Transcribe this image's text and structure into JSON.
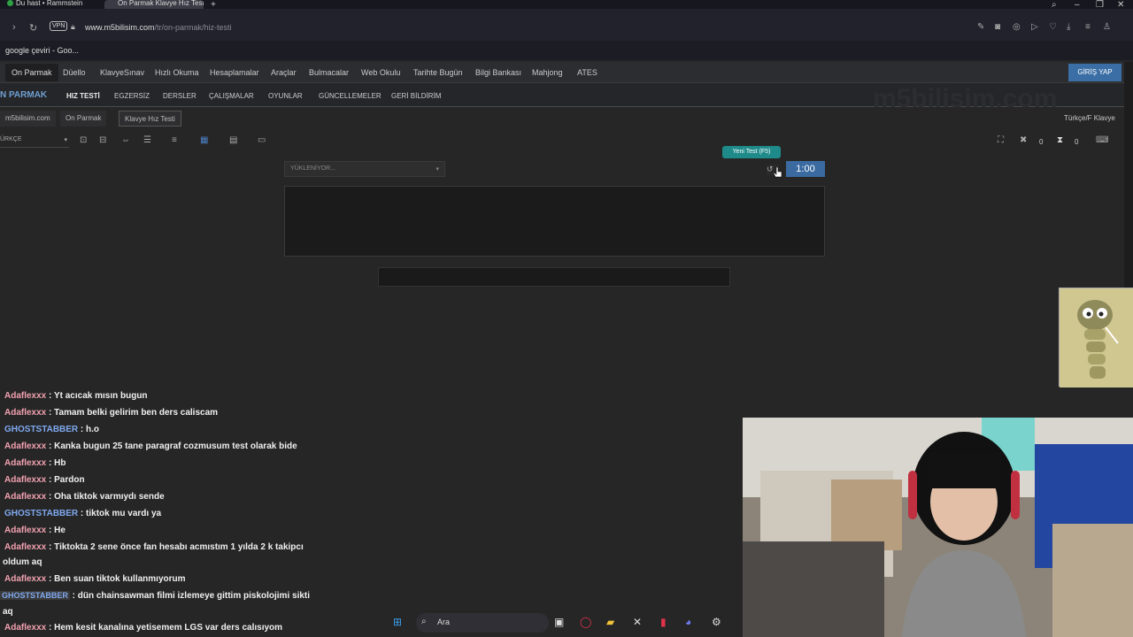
{
  "browser": {
    "tab1": "Du hast • Rammstein",
    "tab2": "On Parmak Klavye Hız Testi",
    "new_tab": "+",
    "vpn": "VPN",
    "url_host": "www.m5bilisim.com",
    "url_path": "/tr/on-parmak/hiz-testi",
    "bookmark": "google çeviri - Goo..."
  },
  "nav": {
    "items": [
      "On Parmak",
      "Düello",
      "KlavyeSınav",
      "Hızlı Okuma",
      "Hesaplamalar",
      "Araçlar",
      "Bulmacalar",
      "Web Okulu",
      "Tarihte Bugün",
      "Bilgi Bankası",
      "Mahjong",
      "ATES"
    ],
    "login": "GİRİŞ YAP"
  },
  "subnav": {
    "brand": "N PARMAK",
    "items": [
      "HIZ TESTİ",
      "EGZERSİZ",
      "DERSLER",
      "ÇALIŞMALAR",
      "OYUNLAR",
      "GÜNCELLEMELER",
      "GERİ BİLDİRİM"
    ],
    "watermark": "m5bilisim.com"
  },
  "breadcrumb": {
    "items": [
      "m5bilisim.com",
      "On Parmak",
      "Klavye Hız Testi"
    ],
    "keyboard": "Türkçe/F Klavye"
  },
  "toolbar": {
    "language": "ÜRKÇE",
    "errors": "0",
    "time_count": "0"
  },
  "test": {
    "select_placeholder": "YÜKLENİYOR...",
    "tooltip": "Yeni Test (F5)",
    "timer": "1:00"
  },
  "chat": [
    {
      "user": "Adaflexxx",
      "text": " : Yt acıcak mısın bugun"
    },
    {
      "user": "Adaflexxx",
      "text": " : Tamam belki gelirim ben ders caliscam"
    },
    {
      "user": "GHOSTSTABBER",
      "text": " : h.o"
    },
    {
      "user": "Adaflexxx",
      "text": " : Kanka bugun 25 tane paragraf cozmusum test olarak bide"
    },
    {
      "user": "Adaflexxx",
      "text": " : Hb"
    },
    {
      "user": "Adaflexxx",
      "text": " : Pardon"
    },
    {
      "user": "Adaflexxx",
      "text": " : Oha tiktok varmıydı sende"
    },
    {
      "user": "GHOSTSTABBER",
      "text": " : tiktok mu vardı ya"
    },
    {
      "user": "Adaflexxx",
      "text": " : He"
    },
    {
      "user": "Adaflexxx",
      "text": " : Tiktokta 2 sene önce fan hesabı acmıstım 1 yılda 2 k takipcı"
    },
    {
      "user": "Adaflexxx",
      "text": " : Ben suan tiktok kullanmıyorum"
    },
    {
      "user": "GHOSTSTABBER",
      "text": " : dün chainsawman filmi izlemeye gittim piskolojimi sikti"
    },
    {
      "user": "Adaflexxx",
      "text": " : Hem kesit kanalına yetisemem LGS var ders calısıyom"
    }
  ],
  "chat_cont": [
    "oldum aq",
    "aq"
  ],
  "taskbar": {
    "search": "Ara"
  }
}
